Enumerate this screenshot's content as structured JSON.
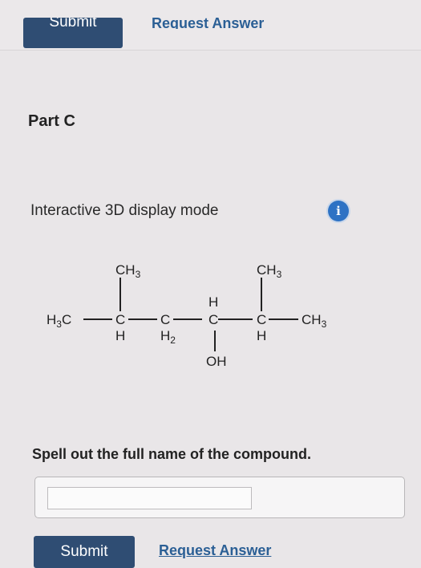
{
  "top_actions": {
    "submit_label": "Submit",
    "request_label": "Request Answer"
  },
  "part": {
    "title": "Part C"
  },
  "display": {
    "mode_text": "Interactive 3D display mode",
    "info_glyph": "i",
    "info_icon": "info-icon"
  },
  "molecule": {
    "ch3_left": "CH",
    "ch3_left_sub": "3",
    "ch3_right": "CH",
    "ch3_right_sub": "3",
    "h3c_main": "H",
    "h3c_sub": "3",
    "h3c_c": "C",
    "c1": "C",
    "c1_h": "H",
    "c2": "C",
    "c2_h": "H",
    "c2_sub": "2",
    "c3_top_h": "H",
    "c3": "C",
    "oh": "OH",
    "c4": "C",
    "c4_h": "H",
    "ch3_end": "CH",
    "ch3_end_sub": "3"
  },
  "question": {
    "prompt": "Spell out the full name of the compound.",
    "answer_value": "",
    "answer_placeholder": ""
  },
  "bottom_actions": {
    "submit_label": "Submit",
    "request_label": "Request Answer"
  },
  "colors": {
    "button_bg": "#2f4d73",
    "link": "#2b5f95",
    "info": "#2e72c4"
  }
}
